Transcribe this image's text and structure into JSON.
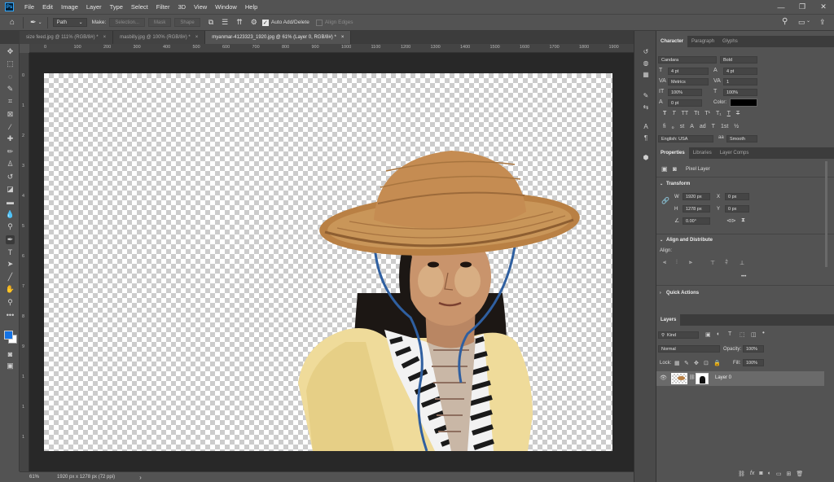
{
  "menu": [
    "File",
    "Edit",
    "Image",
    "Layer",
    "Type",
    "Select",
    "Filter",
    "3D",
    "View",
    "Window",
    "Help"
  ],
  "app_logo": "Ps",
  "options_bar": {
    "mode": "Path",
    "make_label": "Make:",
    "selection_btn": "Selection...",
    "mask_btn": "Mask",
    "shape_btn": "Shape",
    "auto_add_delete": "Auto Add/Delete",
    "align_edges": "Align Edges"
  },
  "tabs": [
    {
      "label": "size feed.jpg @ 111% (RGB/8#) *",
      "close": "×"
    },
    {
      "label": "masbilly.jpg @ 100% (RGB/8#) *",
      "close": "×"
    },
    {
      "label": "myanmar-4123323_1920.jpg @ 61% (Layer 0, RGB/8#) *",
      "close": "×"
    }
  ],
  "ruler_h": [
    "0",
    "100",
    "200",
    "300",
    "400",
    "500",
    "600",
    "700",
    "800",
    "900",
    "1000",
    "1100",
    "1200",
    "1300",
    "1400",
    "1500",
    "1600",
    "1700",
    "1800",
    "1900"
  ],
  "ruler_v": [
    "0",
    "1",
    "2",
    "3",
    "4",
    "5",
    "6",
    "7",
    "8",
    "9",
    "1",
    "1",
    "1"
  ],
  "status": {
    "zoom": "61%",
    "doc": "1920 px x 1278 px (72 ppi)",
    "arrow": "›"
  },
  "character_panel": {
    "tabs": [
      "Character",
      "Paragraph",
      "Glyphs"
    ],
    "font_family": "Candara",
    "font_style": "Bold",
    "size": "4 pt",
    "leading": "4 pt",
    "kerning": "Metrics",
    "tracking": "1",
    "vscale": "100%",
    "hscale": "100%",
    "baseline": "0 pt",
    "color_label": "Color:",
    "language": "English: USA",
    "antialias": "Smooth",
    "style_buttons": [
      "T",
      "T",
      "TT",
      "Tt",
      "T¹",
      "T₁",
      "T",
      "T"
    ],
    "ot_buttons": [
      "fi",
      "ℴ",
      "st",
      "A",
      "ad",
      "T",
      "1st",
      "½"
    ]
  },
  "properties_panel": {
    "tabs": [
      "Properties",
      "Libraries",
      "Layer Comps"
    ],
    "layer_type": "Pixel Layer",
    "transform_title": "Transform",
    "w_label": "W",
    "w_value": "1920 px",
    "h_label": "H",
    "h_value": "1278 px",
    "x_label": "X",
    "x_value": "0 px",
    "y_label": "Y",
    "y_value": "0 px",
    "angle": "0.00°",
    "align_title": "Align and Distribute",
    "align_label": "Align:",
    "more": "•••",
    "quick_actions": "Quick Actions"
  },
  "layers_panel": {
    "tab": "Layers",
    "filter_kind": "Kind",
    "blend_mode": "Normal",
    "opacity_label": "Opacity:",
    "opacity": "100%",
    "lock_label": "Lock:",
    "fill_label": "Fill:",
    "fill": "100%",
    "layers": [
      {
        "name": "Layer 0",
        "visible": true
      }
    ],
    "bottom_icons": [
      "link-icon",
      "fx-icon",
      "mask-icon",
      "adjustment-icon",
      "folder-icon",
      "new-layer-icon",
      "trash-icon"
    ],
    "fx": "fx"
  },
  "colors": {
    "foreground": "#1473e6",
    "background": "#ffffff",
    "accent": "#31a8ff",
    "text_color_swatch": "#000000"
  }
}
